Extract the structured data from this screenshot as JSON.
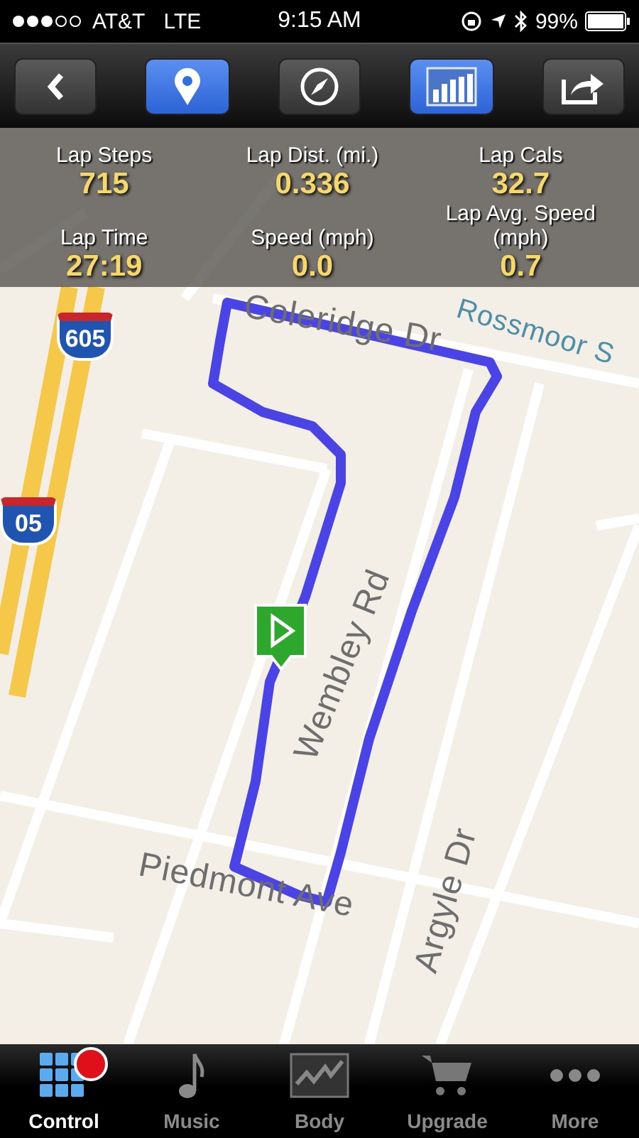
{
  "status_bar": {
    "carrier": "AT&T",
    "network": "LTE",
    "time": "9:15 AM",
    "battery": "99%"
  },
  "toolbar": {
    "buttons": [
      {
        "kind": "back",
        "selected": false
      },
      {
        "kind": "pin",
        "selected": true
      },
      {
        "kind": "compass",
        "selected": false
      },
      {
        "kind": "chart",
        "selected": true
      },
      {
        "kind": "share",
        "selected": false
      }
    ]
  },
  "stats": [
    {
      "label": "Lap Steps",
      "value": "715"
    },
    {
      "label": "Lap Dist. (mi.)",
      "value": "0.336"
    },
    {
      "label": "Lap Cals",
      "value": "32.7"
    },
    {
      "label": "Lap Time",
      "value": "27:19"
    },
    {
      "label": "Speed (mph)",
      "value": "0.0"
    },
    {
      "label": "Lap Avg. Speed (mph)",
      "value": "0.7"
    }
  ],
  "map": {
    "street_labels": [
      {
        "text": "Rossmoor S"
      },
      {
        "text": "Coleridge Dr"
      },
      {
        "text": "Wembley Rd"
      },
      {
        "text": "Piedmont Ave"
      },
      {
        "text": "Argyle Dr"
      }
    ],
    "shields": [
      {
        "text": "605"
      },
      {
        "text": "05"
      }
    ]
  },
  "tabs": [
    {
      "label": "Control",
      "selected": true,
      "badge": true
    },
    {
      "label": "Music",
      "selected": false,
      "badge": false
    },
    {
      "label": "Body",
      "selected": false,
      "badge": false
    },
    {
      "label": "Upgrade",
      "selected": false,
      "badge": false
    },
    {
      "label": "More",
      "selected": false,
      "badge": false
    }
  ]
}
